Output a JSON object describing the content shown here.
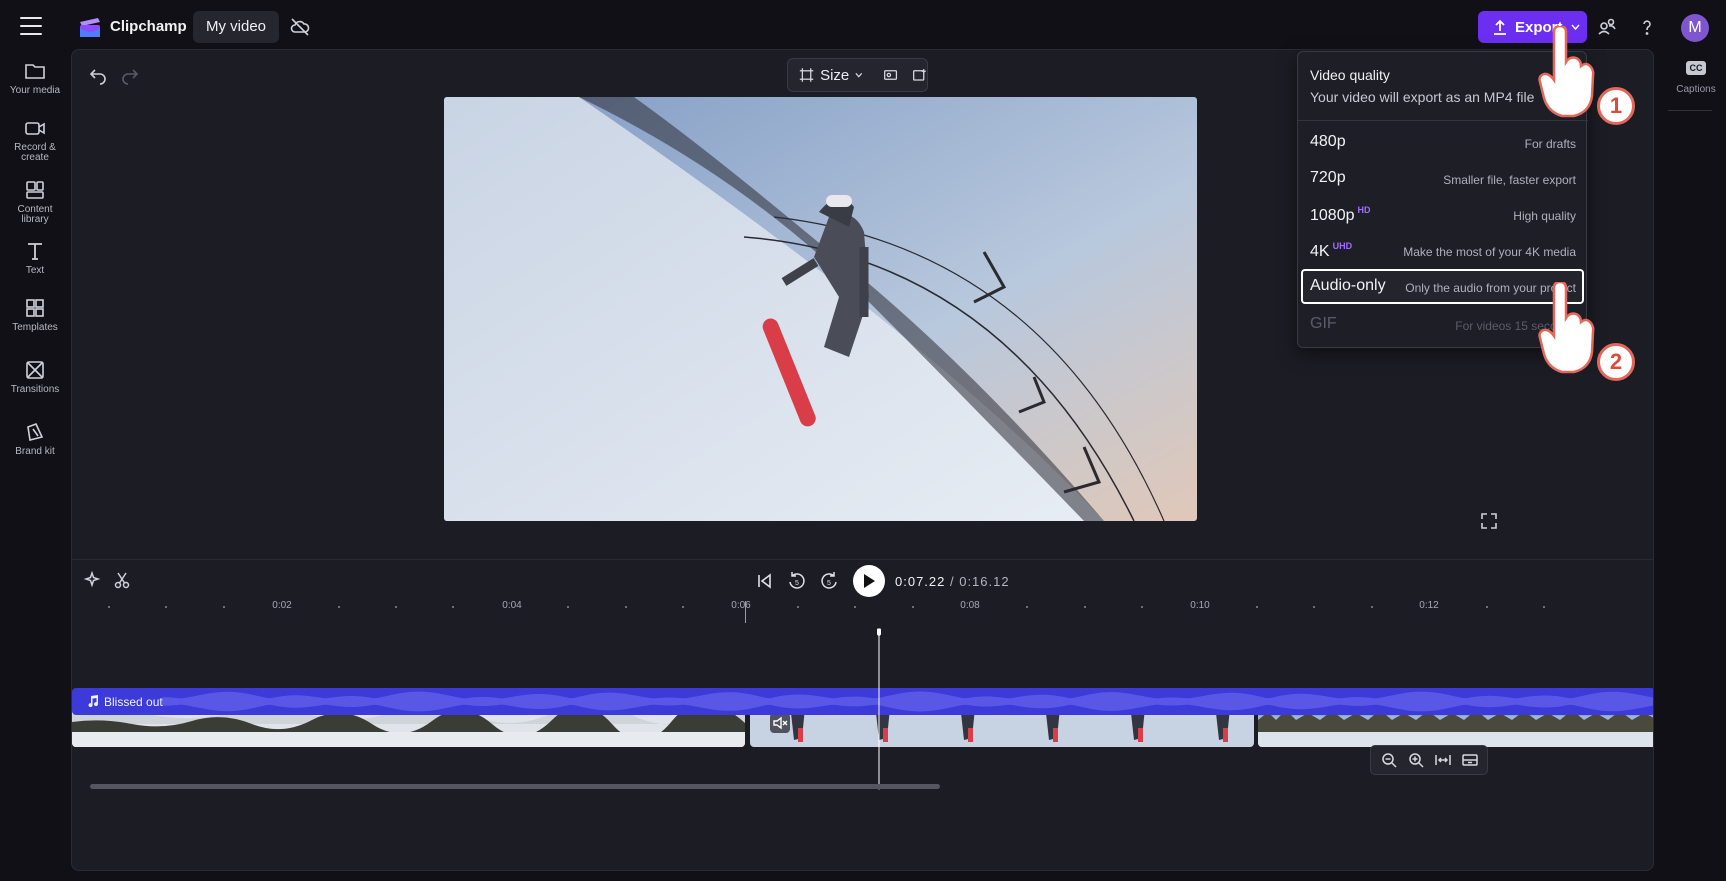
{
  "app": {
    "brand": "Clipchamp",
    "project_name": "My video"
  },
  "header": {
    "export_label": "Export",
    "avatar_initial": "M"
  },
  "sidebar": {
    "items": [
      {
        "label": "Your media",
        "icon": "folder-icon"
      },
      {
        "label": "Record & create",
        "icon": "camera-icon"
      },
      {
        "label": "Content library",
        "icon": "library-icon"
      },
      {
        "label": "Text",
        "icon": "text-icon"
      },
      {
        "label": "Templates",
        "icon": "templates-icon"
      },
      {
        "label": "Transitions",
        "icon": "transitions-icon"
      },
      {
        "label": "Brand kit",
        "icon": "brand-kit-icon"
      }
    ]
  },
  "right_panel": {
    "captions_badge": "CC",
    "captions_label": "Captions"
  },
  "toolbar": {
    "size_label": "Size"
  },
  "playback": {
    "current_time": "0:07.22",
    "separator": " / ",
    "total_time": "0:16.12",
    "skip_back": "5",
    "skip_forward": "5"
  },
  "ruler": {
    "labels": [
      "0:02",
      "0:04",
      "0:06",
      "0:08",
      "0:10",
      "0:12"
    ]
  },
  "audio_track": {
    "name": "Blissed out"
  },
  "export_menu": {
    "title": "Video quality",
    "subtitle": "Your video will export as an MP4 file",
    "options": [
      {
        "quality": "480p",
        "badge": "",
        "desc": "For drafts",
        "state": "normal"
      },
      {
        "quality": "720p",
        "badge": "",
        "desc": "Smaller file, faster export",
        "state": "normal"
      },
      {
        "quality": "1080p",
        "badge": "HD",
        "desc": "High quality",
        "state": "normal"
      },
      {
        "quality": "4K",
        "badge": "UHD",
        "desc": "Make the most of your 4K media",
        "state": "normal"
      },
      {
        "quality": "Audio-only",
        "badge": "",
        "desc": "Only the audio from your project",
        "state": "selected"
      },
      {
        "quality": "GIF",
        "badge": "",
        "desc": "For videos 15 seconds",
        "state": "disabled"
      }
    ]
  },
  "annotations": {
    "step1": "1",
    "step2": "2"
  },
  "colors": {
    "accent": "#6c2ff2",
    "audio_track": "#3c3ad8",
    "badge_outline": "#e5675a"
  }
}
